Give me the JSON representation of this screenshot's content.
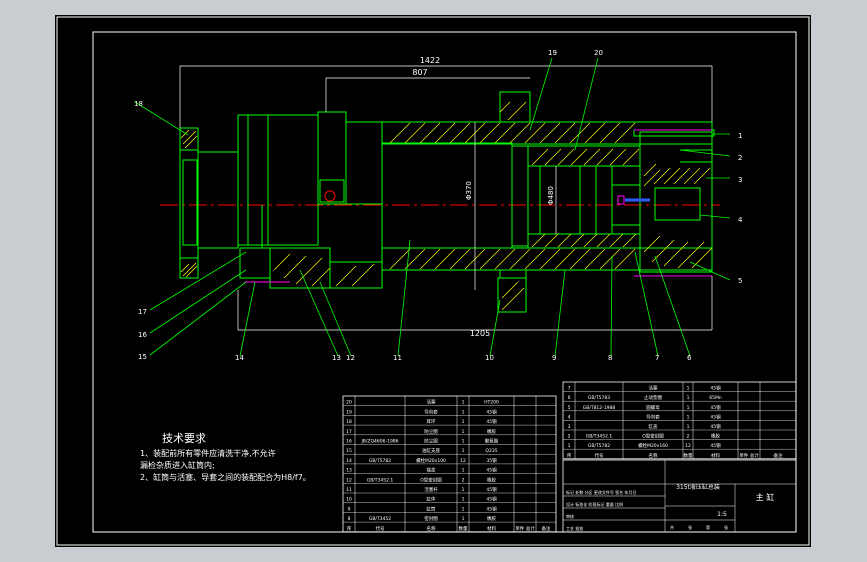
{
  "app": {
    "background_color": "#c9ccd1",
    "sheet_color": "#000000",
    "line_colors": {
      "border": "#ffffff",
      "part": "#00ff00",
      "dimension": "#ffffff",
      "center": "#ff0000",
      "hatch": "#ffff00",
      "accent": "#ff00ff",
      "text": "#ffffff",
      "blue": "#2f5cff"
    }
  },
  "dimensions": {
    "overall": "1422",
    "stroke": "807",
    "lower": "1205",
    "bore_a": "Φ370",
    "bore_b": "Φ480"
  },
  "balloons": {
    "right": [
      "1",
      "2",
      "3",
      "4",
      "5"
    ],
    "top": [
      "19",
      "20"
    ],
    "left": [
      "18",
      "17",
      "16",
      "15"
    ],
    "bottom": [
      "14",
      "13",
      "12",
      "11",
      "10",
      "9",
      "8",
      "7",
      "6"
    ]
  },
  "notes": {
    "title": "技术要求",
    "lines": [
      "1、装配前所有零件应清洗干净,不允许",
      "    漏检杂质进入缸筒内;",
      "2、缸筒与活塞、导套之间的装配配合为H8/f7。"
    ]
  },
  "bom_left": {
    "rows": [
      [
        "20",
        "",
        "活塞",
        "1",
        "HT200"
      ],
      [
        "19",
        "",
        "导向套",
        "1",
        "45钢"
      ],
      [
        "18",
        "",
        "耳环",
        "1",
        "45钢"
      ],
      [
        "17",
        "",
        "防尘圈",
        "1",
        "橡胶"
      ],
      [
        "16",
        "JB/ZQ4606-1986",
        "防尘圈",
        "1",
        "聚氨酯"
      ],
      [
        "15",
        "",
        "油缸支座",
        "1",
        "Q235"
      ],
      [
        "14",
        "GB/T5782",
        "螺栓M20x100",
        "12",
        "35钢"
      ],
      [
        "13",
        "",
        "端盖",
        "1",
        "45钢"
      ],
      [
        "12",
        "GB/T3452.1",
        "O型密封圈",
        "2",
        "橡胶"
      ],
      [
        "11",
        "",
        "活塞杆",
        "1",
        "45钢"
      ],
      [
        "10",
        "",
        "缸体",
        "1",
        "45钢"
      ],
      [
        "9",
        "",
        "缸筒",
        "1",
        "45钢"
      ],
      [
        "8",
        "GB/T3452",
        "密封圈",
        "1",
        "橡胶"
      ]
    ],
    "header": [
      "序",
      "代号",
      "名称",
      "数量",
      "材料",
      "单件 总计",
      "备注"
    ],
    "weight_labels": [
      "单件",
      "总计",
      "重量"
    ]
  },
  "bom_right": {
    "rows": [
      [
        "7",
        "",
        "活塞",
        "1",
        "45钢"
      ],
      [
        "6",
        "GB/T5783",
        "止动垫圈",
        "1",
        "65Mn"
      ],
      [
        "5",
        "GB/T812-1988",
        "圆螺母",
        "1",
        "45钢"
      ],
      [
        "4",
        "",
        "导向套",
        "1",
        "45钢"
      ],
      [
        "3",
        "",
        "缸盖",
        "1",
        "45钢"
      ],
      [
        "2",
        "GB/T3452.1",
        "O型密封圈",
        "2",
        "橡胶"
      ],
      [
        "1",
        "GB/T5782",
        "螺栓M20x160",
        "12",
        "45钢"
      ]
    ],
    "header": [
      "序",
      "代号",
      "名称",
      "数量",
      "材料",
      "单件 总计",
      "备注"
    ]
  },
  "title_block": {
    "drawing_name": "315t液压缸总装",
    "sheet_label": "主 缸",
    "scale": "1:5",
    "sign_rows": [
      "标记 处数 分区 更改文件号 签名 年月日",
      "设计 标准化 阶段标记 重量 比例",
      "审核",
      "工艺 批准"
    ],
    "page_labels": [
      "共",
      "张",
      "第",
      "张"
    ]
  }
}
